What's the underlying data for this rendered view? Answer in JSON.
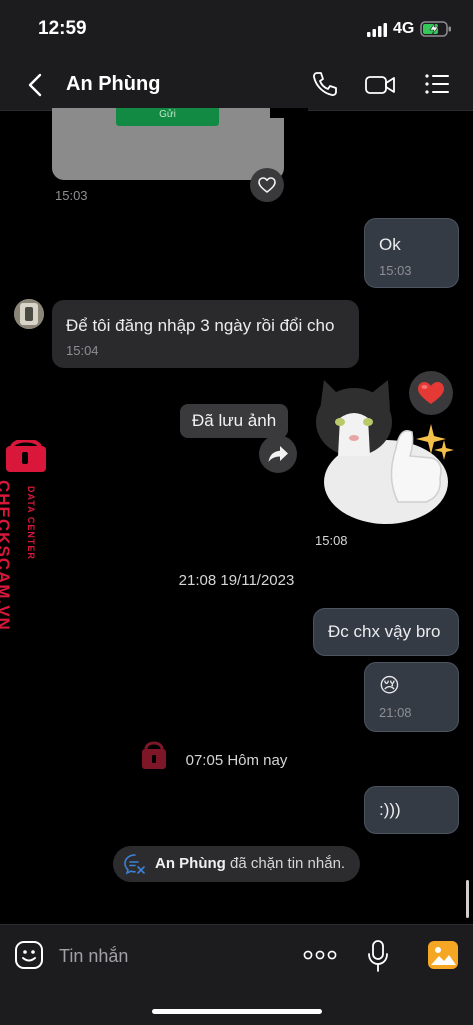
{
  "status_bar": {
    "time": "12:59",
    "network": "4G"
  },
  "header": {
    "contact_name": "An Phùng"
  },
  "messages": {
    "image_preview_button": "Gửi",
    "image_time": "15:03",
    "ok": {
      "text": "Ok",
      "time": "15:03"
    },
    "incoming_1": {
      "text": "Để tôi đăng nhập 3 ngày rồi đổi cho",
      "time": "15:04"
    },
    "saved_label": "Đã lưu ảnh",
    "sticker_time": "15:08",
    "date_separator_1": "21:08 19/11/2023",
    "outgoing_2": {
      "text": "Đc chx vậy bro"
    },
    "outgoing_3": {
      "emoji": "😢",
      "time": "21:08"
    },
    "date_separator_2": "07:05 Hôm nay",
    "outgoing_4": {
      "text": ":)))"
    },
    "system": {
      "name": "An Phùng",
      "text": " đã chặn tin nhắn."
    }
  },
  "watermark": {
    "brand": "CHECKSCAM.VN",
    "sub": "DATA CENTER"
  },
  "composer": {
    "placeholder": "Tin nhắn"
  },
  "colors": {
    "accent_orange": "#f5a623",
    "heart": "#e53935",
    "watermark": "#d8173a"
  }
}
